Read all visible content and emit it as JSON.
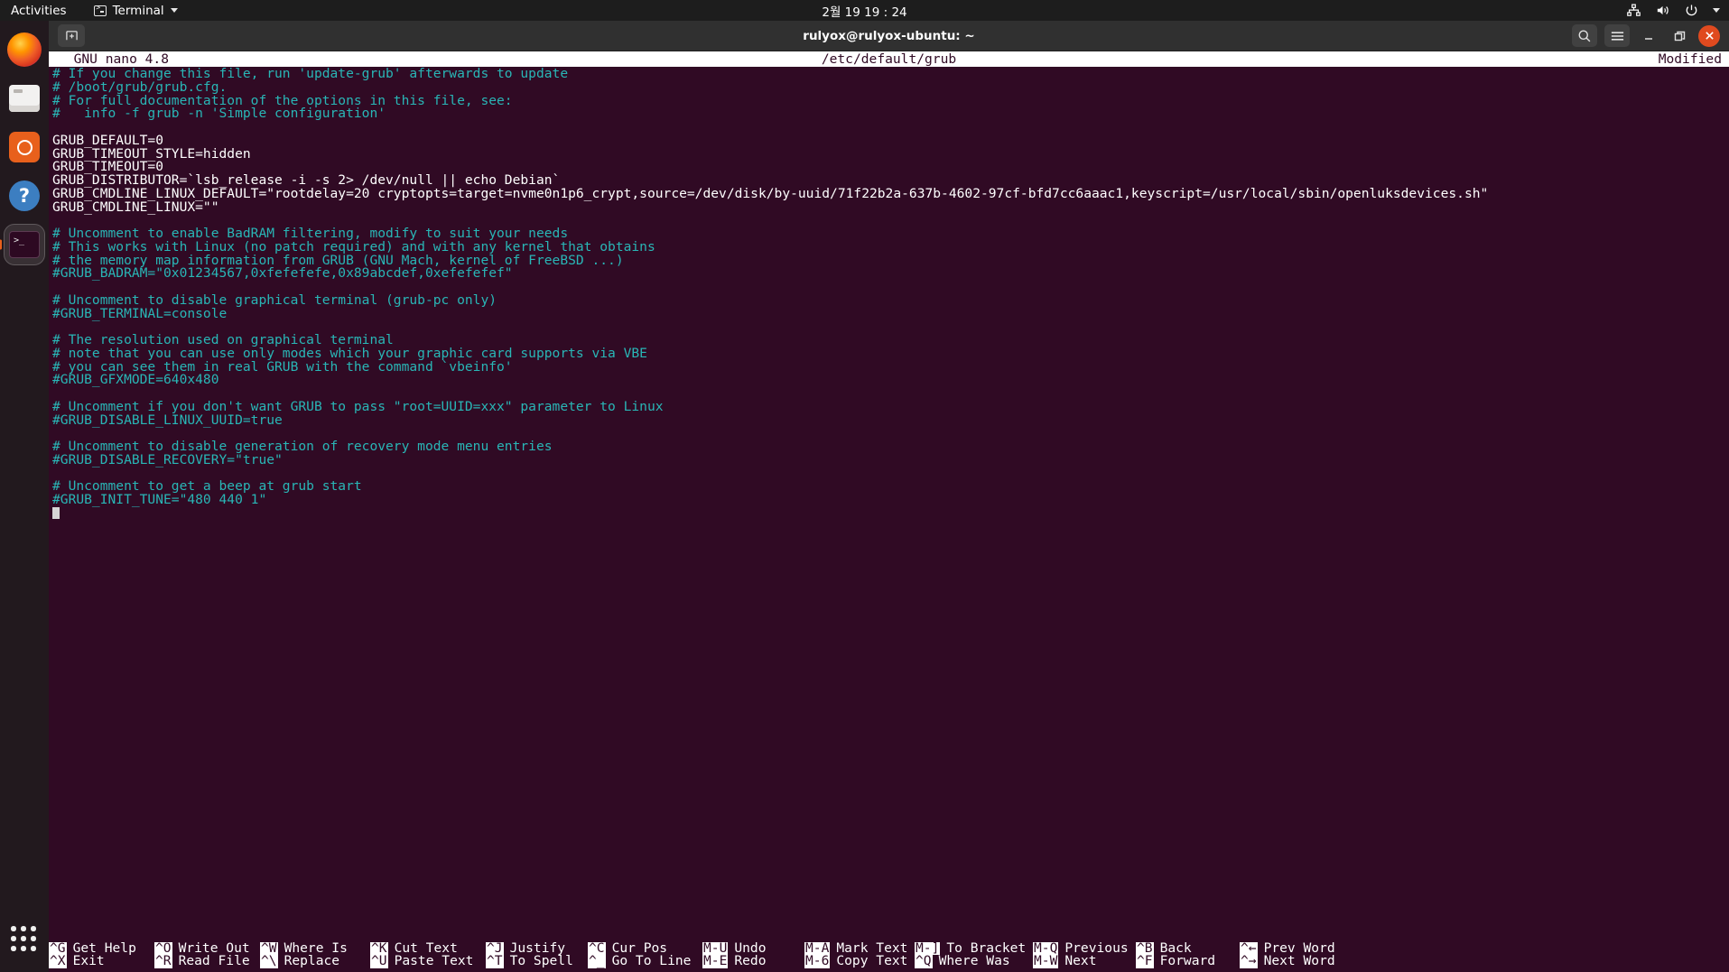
{
  "topbar": {
    "activities": "Activities",
    "app_name": "Terminal",
    "app_icon": "terminal-icon",
    "clock": "2월 19  19 : 24",
    "tray": [
      {
        "name": "network-icon"
      },
      {
        "name": "volume-icon"
      },
      {
        "name": "power-icon"
      },
      {
        "name": "chevron-down-icon"
      }
    ]
  },
  "dock": {
    "items": [
      {
        "name": "firefox",
        "label": "Firefox"
      },
      {
        "name": "files",
        "label": "Files"
      },
      {
        "name": "software",
        "label": "Ubuntu Software"
      },
      {
        "name": "help",
        "label": "Help",
        "glyph": "?"
      },
      {
        "name": "terminal",
        "label": "Terminal",
        "running": true
      }
    ],
    "show_apps_label": "Show Applications"
  },
  "window": {
    "title": "rulyox@rulyox-ubuntu: ~",
    "new_tab_label": "+",
    "controls": {
      "search": "search-icon",
      "menu": "hamburger-menu-icon",
      "minimize": "minimize-icon",
      "maximize": "maximize-icon",
      "close": "close-icon"
    }
  },
  "nano": {
    "version": "  GNU nano 4.8",
    "filename": "/etc/default/grub",
    "status": "Modified",
    "lines": [
      {
        "t": "# If you change this file, run 'update-grub' afterwards to update",
        "c": true
      },
      {
        "t": "# /boot/grub/grub.cfg.",
        "c": true
      },
      {
        "t": "# For full documentation of the options in this file, see:",
        "c": true
      },
      {
        "t": "#   info -f grub -n 'Simple configuration'",
        "c": true
      },
      {
        "t": "",
        "c": false
      },
      {
        "t": "GRUB_DEFAULT=0",
        "c": false
      },
      {
        "t": "GRUB_TIMEOUT_STYLE=hidden",
        "c": false
      },
      {
        "t": "GRUB_TIMEOUT=0",
        "c": false
      },
      {
        "t": "GRUB_DISTRIBUTOR=`lsb_release -i -s 2> /dev/null || echo Debian`",
        "c": false
      },
      {
        "t": "GRUB_CMDLINE_LINUX_DEFAULT=\"rootdelay=20 cryptopts=target=nvme0n1p6_crypt,source=/dev/disk/by-uuid/71f22b2a-637b-4602-97cf-bfd7cc6aaac1,keyscript=/usr/local/sbin/openluksdevices.sh\"",
        "c": false
      },
      {
        "t": "GRUB_CMDLINE_LINUX=\"\"",
        "c": false
      },
      {
        "t": "",
        "c": false
      },
      {
        "t": "# Uncomment to enable BadRAM filtering, modify to suit your needs",
        "c": true
      },
      {
        "t": "# This works with Linux (no patch required) and with any kernel that obtains",
        "c": true
      },
      {
        "t": "# the memory map information from GRUB (GNU Mach, kernel of FreeBSD ...)",
        "c": true
      },
      {
        "t": "#GRUB_BADRAM=\"0x01234567,0xfefefefe,0x89abcdef,0xefefefef\"",
        "c": true
      },
      {
        "t": "",
        "c": false
      },
      {
        "t": "# Uncomment to disable graphical terminal (grub-pc only)",
        "c": true
      },
      {
        "t": "#GRUB_TERMINAL=console",
        "c": true
      },
      {
        "t": "",
        "c": false
      },
      {
        "t": "# The resolution used on graphical terminal",
        "c": true
      },
      {
        "t": "# note that you can use only modes which your graphic card supports via VBE",
        "c": true
      },
      {
        "t": "# you can see them in real GRUB with the command `vbeinfo'",
        "c": true
      },
      {
        "t": "#GRUB_GFXMODE=640x480",
        "c": true
      },
      {
        "t": "",
        "c": false
      },
      {
        "t": "# Uncomment if you don't want GRUB to pass \"root=UUID=xxx\" parameter to Linux",
        "c": true
      },
      {
        "t": "#GRUB_DISABLE_LINUX_UUID=true",
        "c": true
      },
      {
        "t": "",
        "c": false
      },
      {
        "t": "# Uncomment to disable generation of recovery mode menu entries",
        "c": true
      },
      {
        "t": "#GRUB_DISABLE_RECOVERY=\"true\"",
        "c": true
      },
      {
        "t": "",
        "c": false
      },
      {
        "t": "# Uncomment to get a beep at grub start",
        "c": true
      },
      {
        "t": "#GRUB_INIT_TUNE=\"480 440 1\"",
        "c": true
      }
    ],
    "shortcuts_row1": [
      {
        "key": "^G",
        "label": "Get Help"
      },
      {
        "key": "^O",
        "label": "Write Out"
      },
      {
        "key": "^W",
        "label": "Where Is"
      },
      {
        "key": "^K",
        "label": "Cut Text"
      },
      {
        "key": "^J",
        "label": "Justify"
      },
      {
        "key": "^C",
        "label": "Cur Pos"
      },
      {
        "key": "M-U",
        "label": "Undo"
      },
      {
        "key": "M-A",
        "label": "Mark Text"
      },
      {
        "key": "M-]",
        "label": "To Bracket"
      },
      {
        "key": "M-Q",
        "label": "Previous"
      },
      {
        "key": "^B",
        "label": "Back"
      },
      {
        "key": "^←",
        "label": "Prev Word"
      }
    ],
    "shortcuts_row2": [
      {
        "key": "^X",
        "label": "Exit"
      },
      {
        "key": "^R",
        "label": "Read File"
      },
      {
        "key": "^\\",
        "label": "Replace"
      },
      {
        "key": "^U",
        "label": "Paste Text"
      },
      {
        "key": "^T",
        "label": "To Spell"
      },
      {
        "key": "^_",
        "label": "Go To Line"
      },
      {
        "key": "M-E",
        "label": "Redo"
      },
      {
        "key": "M-6",
        "label": "Copy Text"
      },
      {
        "key": "^Q",
        "label": "Where Was"
      },
      {
        "key": "M-W",
        "label": "Next"
      },
      {
        "key": "^F",
        "label": "Forward"
      },
      {
        "key": "^→",
        "label": "Next Word"
      }
    ]
  }
}
